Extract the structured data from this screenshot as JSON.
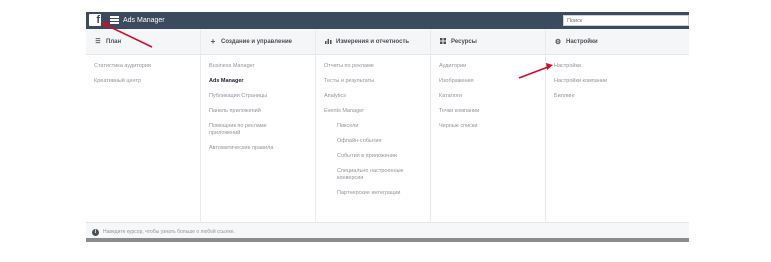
{
  "topbar": {
    "logo_letter": "f",
    "app_title": "Ads Manager",
    "search_placeholder": "Поиск"
  },
  "columns": [
    {
      "title": "План",
      "icon": "list-icon",
      "items": [
        {
          "label": "Статистика аудитории",
          "style": "normal"
        },
        {
          "label": "Креативный центр",
          "style": "normal"
        }
      ]
    },
    {
      "title": "Создание и управление",
      "icon": "plus-icon",
      "items": [
        {
          "label": "Business Manager",
          "style": "normal"
        },
        {
          "label": "Ads Manager",
          "style": "bold"
        },
        {
          "label": "Публикация Страницы",
          "style": "normal"
        },
        {
          "label": "Панель приложений",
          "style": "normal"
        },
        {
          "label": "Помощник по рекламе приложений",
          "style": "normal"
        },
        {
          "label": "Автоматические правила",
          "style": "normal"
        }
      ]
    },
    {
      "title": "Измерения и отчетность",
      "icon": "bar-chart-icon",
      "items": [
        {
          "label": "Отчеты по рекламе",
          "style": "normal"
        },
        {
          "label": "Тесты и результаты",
          "style": "normal"
        },
        {
          "label": "Analytics",
          "style": "normal"
        },
        {
          "label": "Events Manager",
          "style": "normal"
        },
        {
          "label": "Пиксели",
          "style": "sub"
        },
        {
          "label": "Офлайн-события",
          "style": "sub"
        },
        {
          "label": "События в приложении",
          "style": "sub"
        },
        {
          "label": "Специально настроенные конверсии",
          "style": "sub"
        },
        {
          "label": "Партнерские интеграции",
          "style": "sub"
        }
      ]
    },
    {
      "title": "Ресурсы",
      "icon": "grid-icon",
      "items": [
        {
          "label": "Аудитории",
          "style": "normal"
        },
        {
          "label": "Изображения",
          "style": "normal"
        },
        {
          "label": "Каталоги",
          "style": "normal"
        },
        {
          "label": "Точки компании",
          "style": "normal"
        },
        {
          "label": "Черные списки",
          "style": "normal"
        }
      ]
    },
    {
      "title": "Настройки",
      "icon": "gear-icon",
      "items": [
        {
          "label": "Настройки",
          "style": "normal"
        },
        {
          "label": "Настройки компании",
          "style": "normal"
        },
        {
          "label": "Биллинг",
          "style": "normal"
        }
      ]
    }
  ],
  "footer": {
    "info_glyph": "i",
    "text": "Наведите курсор, чтобы узнать больше о любой ссылке."
  },
  "colors": {
    "topbar": "#3b4a5c",
    "arrow": "#c8102e"
  }
}
